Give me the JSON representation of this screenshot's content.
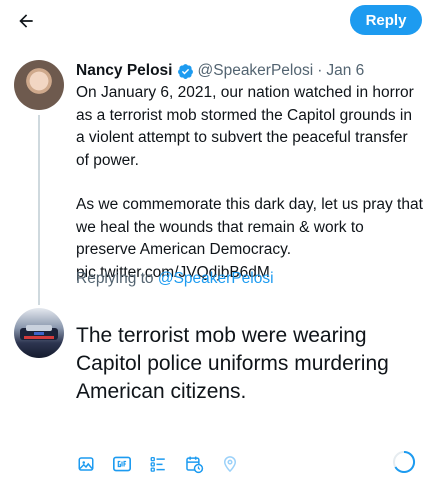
{
  "header": {
    "reply_label": "Reply"
  },
  "tweet": {
    "author_name": "Nancy Pelosi",
    "handle": "@SpeakerPelosi",
    "separator": "·",
    "date": "Jan 6",
    "paragraph1_lines": [
      "On January 6, 2021, our nation watched in horror",
      "as a terrorist mob stormed the Capitol grounds in",
      "a violent attempt to subvert the peaceful transfer",
      "of power."
    ],
    "paragraph2_lines": [
      "As we commemorate this dark day, let us pray that",
      "we heal the wounds that remain & work to",
      "preserve American Democracy.",
      "pic.twitter.com/JVQdjbB6dM"
    ]
  },
  "replying": {
    "prefix": "Replying to ",
    "mention": "@SpeakerPelosi"
  },
  "compose": {
    "lines": [
      "The terrorist mob were wearing",
      "Capitol police uniforms murdering",
      "American citizens."
    ]
  },
  "colors": {
    "accent": "#1d9bf0",
    "secondary_text": "#536471"
  },
  "toolbar_icons": [
    "image-icon",
    "gif-icon",
    "poll-icon",
    "schedule-icon",
    "location-icon"
  ]
}
